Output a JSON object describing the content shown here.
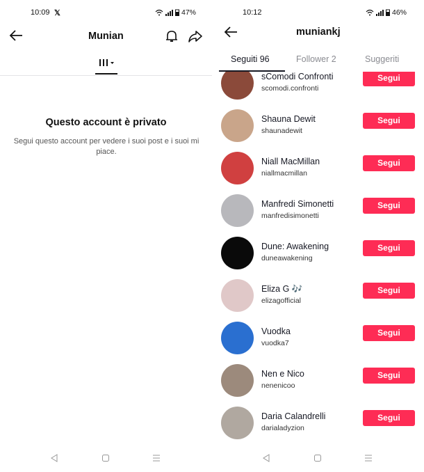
{
  "left": {
    "status": {
      "time": "10:09",
      "app_icon": "x-logo-icon",
      "battery": "47%"
    },
    "header": {
      "title": "Munian"
    },
    "grid_tab_icon": "grid-bars-icon",
    "private": {
      "title": "Questo account è privato",
      "description": "Segui questo account per vedere i suoi post e i suoi mi piace."
    }
  },
  "right": {
    "status": {
      "time": "10:12",
      "battery": "46%"
    },
    "header": {
      "title": "muniankj"
    },
    "tabs": [
      {
        "label": "Seguiti 96",
        "active": true
      },
      {
        "label": "Follower 2",
        "active": false
      },
      {
        "label": "Suggeriti",
        "active": false
      }
    ],
    "follow_label": "Segui",
    "users": [
      {
        "name": "sComodi Confronti",
        "handle": "scomodi.confronti",
        "color": "#8b4a3a"
      },
      {
        "name": "Shauna Dewit",
        "handle": "shaunadewit",
        "color": "#c9a58a"
      },
      {
        "name": "Niall MacMillan",
        "handle": "niallmacmillan",
        "color": "#d04040"
      },
      {
        "name": "Manfredi Simonetti",
        "handle": "manfredisimonetti",
        "color": "#b8b8bc"
      },
      {
        "name": "Dune: Awakening",
        "handle": "duneawakening",
        "color": "#0a0a0a"
      },
      {
        "name": "Eliza G 🎶",
        "handle": "elizagofficial",
        "color": "#e0c8c8"
      },
      {
        "name": "Vuodka",
        "handle": "vuodka7",
        "color": "#2a6fd0"
      },
      {
        "name": "Nen e Nico",
        "handle": "nenenicoo",
        "color": "#9c8a7c"
      },
      {
        "name": "Daria Calandrelli",
        "handle": "darialadyzion",
        "color": "#b0a8a0"
      }
    ]
  },
  "colors": {
    "accent": "#fe2c55",
    "text": "#161823",
    "muted": "#8a8b91"
  }
}
